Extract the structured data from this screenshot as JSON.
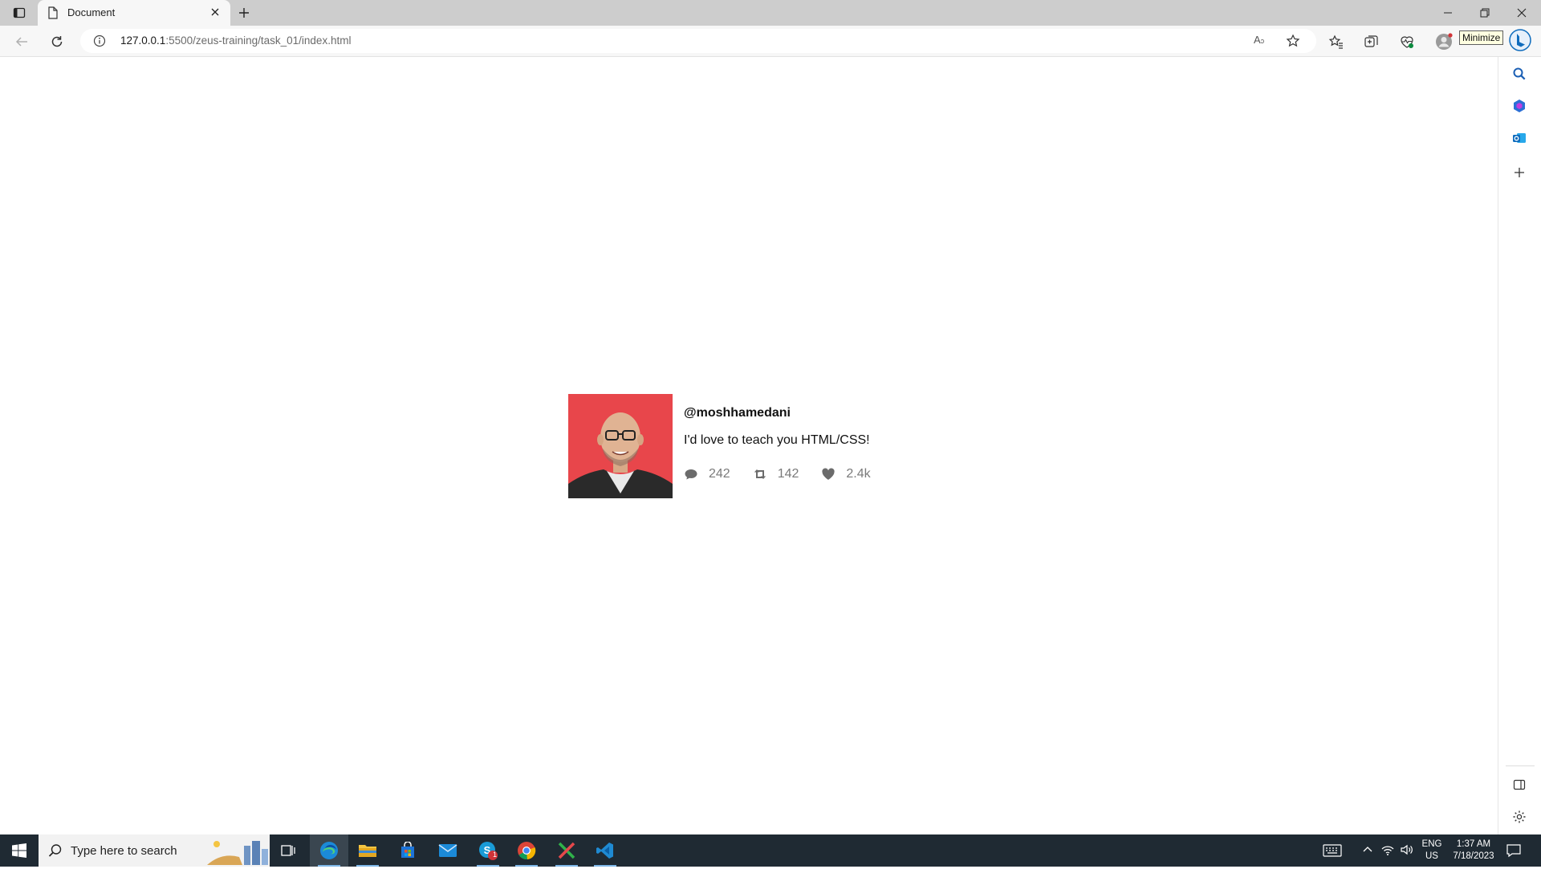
{
  "browser": {
    "tab": {
      "title": "Document"
    },
    "address": {
      "host": "127.0.0.1",
      "rest": ":5500/zeus-training/task_01/index.html"
    },
    "tooltip": "Minimize",
    "read_aloud_label": "A"
  },
  "tweet": {
    "handle": "@moshhamedani",
    "text": "I'd love to teach you HTML/CSS!",
    "stats": {
      "comments": "242",
      "retweets": "142",
      "likes": "2.4k"
    }
  },
  "taskbar": {
    "search_placeholder": "Type here to search",
    "lang": "ENG",
    "region": "US",
    "time": "1:37 AM",
    "date": "7/18/2023",
    "skype_badge": "1"
  },
  "colors": {
    "avatar_bg": "#e8464b",
    "taskbar": "#1f2a33",
    "accent": "#0f6cbd"
  }
}
